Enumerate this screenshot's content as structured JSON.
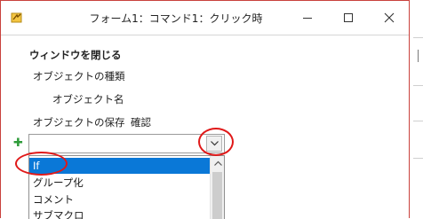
{
  "window": {
    "title": "フォーム1：コマンド1：クリック時",
    "icon": "macro-icon",
    "controls": [
      "minimize-icon",
      "maximize-icon",
      "close-icon"
    ]
  },
  "action": {
    "name": "ウィンドウを閉じる",
    "params": [
      {
        "label": "オブジェクトの種類"
      },
      {
        "label": "オブジェクト名"
      },
      {
        "label": "オブジェクトの保存",
        "value": "確認"
      }
    ]
  },
  "new_action": {
    "add_icon": "plus-icon",
    "value": "",
    "options": [
      "If",
      "グループ化",
      "コメント",
      "サブマクロ"
    ],
    "selected": "If"
  },
  "colors": {
    "selection": "#0a78d7",
    "annotation": "#e01919",
    "window_border": "#c9413c",
    "add_icon": "#2e9b3a"
  }
}
